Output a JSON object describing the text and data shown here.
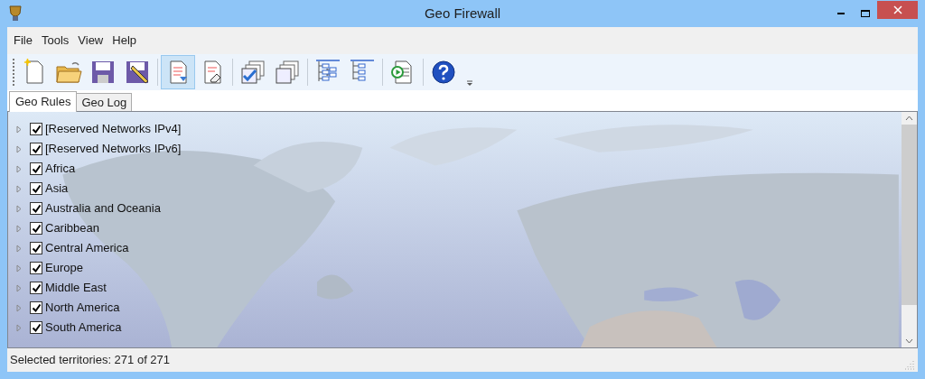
{
  "window": {
    "title": "Geo Firewall"
  },
  "menu": [
    "File",
    "Tools",
    "View",
    "Help"
  ],
  "toolbar": [
    {
      "kind": "new",
      "pressed": false
    },
    {
      "kind": "open",
      "pressed": false
    },
    {
      "kind": "save",
      "pressed": false
    },
    {
      "kind": "save-as",
      "pressed": false
    },
    {
      "kind": "import",
      "pressed": true
    },
    {
      "kind": "clear",
      "pressed": false
    },
    {
      "kind": "check-all",
      "pressed": false
    },
    {
      "kind": "uncheck-all",
      "pressed": false
    },
    {
      "kind": "expand",
      "pressed": false
    },
    {
      "kind": "collapse",
      "pressed": false
    },
    {
      "kind": "run",
      "pressed": false
    },
    {
      "kind": "help",
      "pressed": false
    }
  ],
  "tabs": [
    {
      "label": "Geo Rules",
      "selected": true
    },
    {
      "label": "Geo Log",
      "selected": false
    }
  ],
  "tree": [
    {
      "label": "[Reserved Networks IPv4]",
      "checked": true,
      "expanded": false
    },
    {
      "label": "[Reserved Networks IPv6]",
      "checked": true,
      "expanded": false
    },
    {
      "label": "Africa",
      "checked": true,
      "expanded": false
    },
    {
      "label": "Asia",
      "checked": true,
      "expanded": false
    },
    {
      "label": "Australia and Oceania",
      "checked": true,
      "expanded": false
    },
    {
      "label": "Caribbean",
      "checked": true,
      "expanded": false
    },
    {
      "label": "Central America",
      "checked": true,
      "expanded": false
    },
    {
      "label": "Europe",
      "checked": true,
      "expanded": false
    },
    {
      "label": "Middle East",
      "checked": true,
      "expanded": false
    },
    {
      "label": "North America",
      "checked": true,
      "expanded": false
    },
    {
      "label": "South America",
      "checked": true,
      "expanded": false
    }
  ],
  "status_bar": "Selected territories: 271 of 271"
}
